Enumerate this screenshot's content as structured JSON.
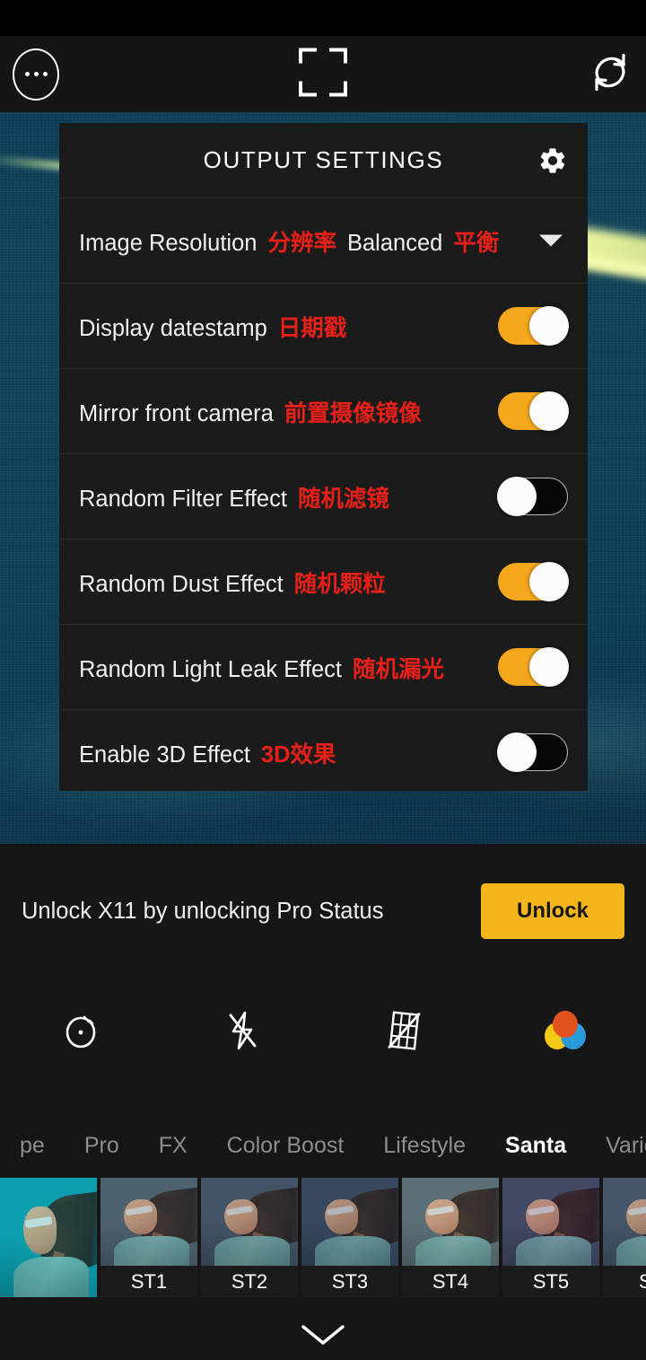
{
  "topbar": {
    "more_icon": "ellipsis-circle-icon",
    "crop_icon": "crop-frame-icon",
    "switch_camera_icon": "switch-camera-icon"
  },
  "panel": {
    "title": "OUTPUT SETTINGS",
    "gear_icon": "gear-icon",
    "rows": [
      {
        "type": "dropdown",
        "label_en": "Image Resolution",
        "label_cn": "分辨率",
        "value_en": "Balanced",
        "value_cn": "平衡",
        "caret_icon": "chevron-down-icon"
      },
      {
        "type": "toggle",
        "label_en": "Display datestamp",
        "label_cn": "日期戳",
        "state": "on"
      },
      {
        "type": "toggle",
        "label_en": "Mirror front camera",
        "label_cn": "前置摄像镜像",
        "state": "on"
      },
      {
        "type": "toggle",
        "label_en": "Random Filter Effect",
        "label_cn": "随机滤镜",
        "state": "off"
      },
      {
        "type": "toggle",
        "label_en": "Random Dust Effect",
        "label_cn": "随机颗粒",
        "state": "on"
      },
      {
        "type": "toggle",
        "label_en": "Random Light Leak Effect",
        "label_cn": "随机漏光",
        "state": "on"
      },
      {
        "type": "toggle",
        "label_en": "Enable 3D Effect",
        "label_cn": "3D效果",
        "state": "off"
      }
    ]
  },
  "promo": {
    "text": "Unlock X11 by unlocking Pro Status",
    "button_label": "Unlock"
  },
  "camera_controls": [
    {
      "name": "self-timer-icon",
      "label": "Self timer"
    },
    {
      "name": "flash-off-icon",
      "label": "Flash off"
    },
    {
      "name": "grid-off-icon",
      "label": "Grid off"
    },
    {
      "name": "color-filter-icon",
      "label": "Color filters"
    }
  ],
  "filter_tabs": [
    {
      "label": "pe",
      "active": false
    },
    {
      "label": "Pro",
      "active": false
    },
    {
      "label": "FX",
      "active": false
    },
    {
      "label": "Color Boost",
      "active": false
    },
    {
      "label": "Lifestyle",
      "active": false
    },
    {
      "label": "Santa",
      "active": true
    },
    {
      "label": "Various",
      "active": false
    }
  ],
  "thumbnails": [
    {
      "label": "",
      "selected": true,
      "tint": "rgba(0,170,180,0.55)",
      "bg": "#0f9bad"
    },
    {
      "label": "ST1",
      "selected": false,
      "tint": "rgba(70,90,110,0.35)",
      "bg": "#50636f"
    },
    {
      "label": "ST2",
      "selected": false,
      "tint": "rgba(60,75,95,0.38)",
      "bg": "#46566a"
    },
    {
      "label": "ST3",
      "selected": false,
      "tint": "rgba(45,62,85,0.42)",
      "bg": "#3b4d63"
    },
    {
      "label": "ST4",
      "selected": false,
      "tint": "rgba(95,110,118,0.32)",
      "bg": "#5d7076"
    },
    {
      "label": "ST5",
      "selected": false,
      "tint": "rgba(55,70,92,0.38)",
      "bg": "#425366"
    },
    {
      "label": "ST",
      "selected": false,
      "tint": "rgba(60,78,98,0.38)",
      "bg": "#48596c"
    }
  ],
  "footer": {
    "collapse_icon": "chevron-down-icon"
  },
  "colors": {
    "accent": "#f5a81c",
    "promo_button": "#f5b61c",
    "cn_red": "#e8201a",
    "panel_bg": "#1b1b1b",
    "bottom_bg": "#161616"
  }
}
